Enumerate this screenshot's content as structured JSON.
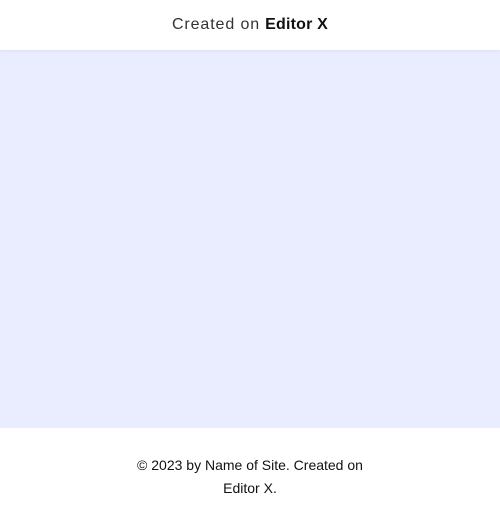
{
  "banner": {
    "prefix": "Created on",
    "brand": "Editor X"
  },
  "main": {
    "background_color": "#eaedff"
  },
  "footer": {
    "text": "© 2023 by Name of Site. Created on Editor X."
  }
}
